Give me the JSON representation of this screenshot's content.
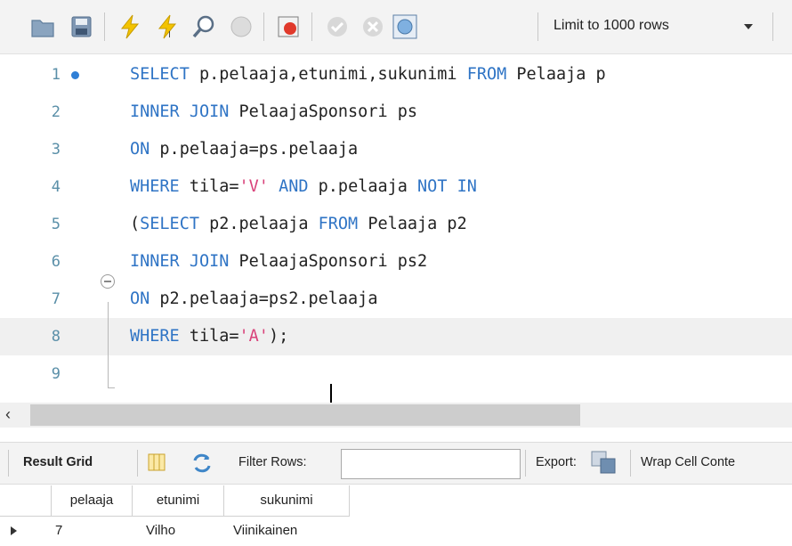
{
  "toolbar": {
    "icons": [
      "open-folder-icon",
      "save-icon",
      "execute-icon",
      "execute-current-icon",
      "explain-icon",
      "stop-icon",
      "toggle-error-icon",
      "commit-icon",
      "rollback-icon",
      "autocommit-icon"
    ],
    "limit_label": "Limit to 1000 rows"
  },
  "editor": {
    "lines": [
      {
        "num": "1",
        "tokens": [
          {
            "t": "SELECT",
            "k": "kw"
          },
          {
            "t": " p.pelaaja,etunimi,sukunimi ",
            "k": ""
          },
          {
            "t": "FROM",
            "k": "kw"
          },
          {
            "t": " Pelaaja p",
            "k": ""
          }
        ]
      },
      {
        "num": "2",
        "tokens": [
          {
            "t": "INNER JOIN",
            "k": "kw"
          },
          {
            "t": " PelaajaSponsori ps",
            "k": ""
          }
        ]
      },
      {
        "num": "3",
        "tokens": [
          {
            "t": "ON",
            "k": "kw"
          },
          {
            "t": " p.pelaaja=ps.pelaaja",
            "k": ""
          }
        ]
      },
      {
        "num": "4",
        "tokens": [
          {
            "t": "WHERE",
            "k": "kw"
          },
          {
            "t": " tila=",
            "k": ""
          },
          {
            "t": "'V'",
            "k": "str"
          },
          {
            "t": " ",
            "k": ""
          },
          {
            "t": "AND",
            "k": "kw"
          },
          {
            "t": " p.pelaaja ",
            "k": ""
          },
          {
            "t": "NOT IN",
            "k": "kw"
          }
        ]
      },
      {
        "num": "5",
        "tokens": [
          {
            "t": "(",
            "k": ""
          },
          {
            "t": "SELECT",
            "k": "kw"
          },
          {
            "t": " p2.pelaaja ",
            "k": ""
          },
          {
            "t": "FROM",
            "k": "kw"
          },
          {
            "t": " Pelaaja p2",
            "k": ""
          }
        ]
      },
      {
        "num": "6",
        "tokens": [
          {
            "t": "INNER JOIN",
            "k": "kw"
          },
          {
            "t": " PelaajaSponsori ps2",
            "k": ""
          }
        ]
      },
      {
        "num": "7",
        "tokens": [
          {
            "t": "ON",
            "k": "kw"
          },
          {
            "t": " p2.pelaaja=ps2.pelaaja",
            "k": ""
          }
        ]
      },
      {
        "num": "8",
        "tokens": [
          {
            "t": "WHERE",
            "k": "kw"
          },
          {
            "t": " tila=",
            "k": ""
          },
          {
            "t": "'A'",
            "k": "str"
          },
          {
            "t": ");",
            "k": ""
          }
        ]
      },
      {
        "num": "9",
        "tokens": []
      }
    ]
  },
  "result_bar": {
    "result_grid_label": "Result Grid",
    "filter_label": "Filter Rows:",
    "filter_value": "",
    "export_label": "Export:",
    "wrap_label": "Wrap Cell Conte"
  },
  "grid": {
    "columns": [
      "pelaaja",
      "etunimi",
      "sukunimi"
    ],
    "rows": [
      [
        "7",
        "Vilho",
        "Viinikainen"
      ]
    ]
  },
  "colors": {
    "keyword": "#2f74c5",
    "string": "#d9427a",
    "line_number": "#5a8fa8"
  }
}
